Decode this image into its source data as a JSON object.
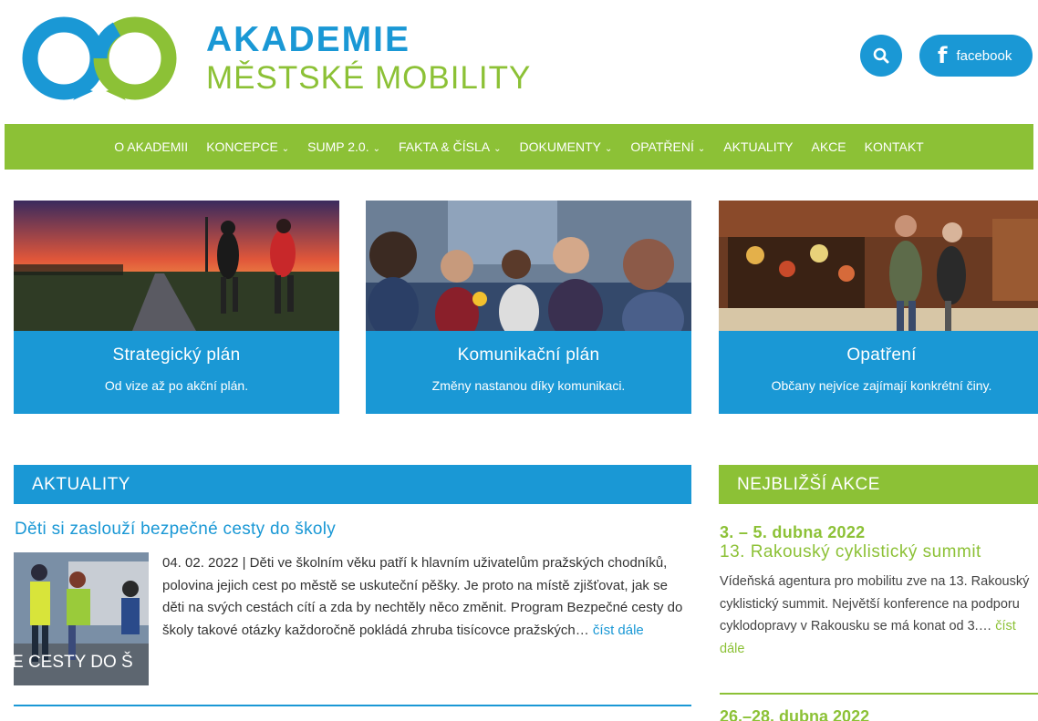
{
  "brand": {
    "line1": "AKADEMIE",
    "line2": "MĚSTSKÉ MOBILITY"
  },
  "header": {
    "search_icon": "search-icon",
    "facebook_icon": "facebook-icon",
    "facebook_label": "facebook"
  },
  "nav": {
    "items": [
      {
        "label": "O AKADEMII",
        "dropdown": false
      },
      {
        "label": "KONCEPCE",
        "dropdown": true
      },
      {
        "label": "SUMP 2.0.",
        "dropdown": true
      },
      {
        "label": "FAKTA & ČÍSLA",
        "dropdown": true
      },
      {
        "label": "DOKUMENTY",
        "dropdown": true
      },
      {
        "label": "OPATŘENÍ",
        "dropdown": true
      },
      {
        "label": "AKTUALITY",
        "dropdown": false
      },
      {
        "label": "AKCE",
        "dropdown": false
      },
      {
        "label": "KONTAKT",
        "dropdown": false
      }
    ]
  },
  "cards": [
    {
      "title": "Strategický plán",
      "subtitle": "Od vize až po akční plán."
    },
    {
      "title": "Komunikační plán",
      "subtitle": "Změny nastanou díky komunikaci."
    },
    {
      "title": "Opatření",
      "subtitle": "Občany nejvíce zajímají konkrétní činy."
    }
  ],
  "news": {
    "heading": "AKTUALITY",
    "item": {
      "title": "Děti si zaslouží bezpečné cesty do školy",
      "thumb_caption": "E CESTY DO Š",
      "date": "04. 02. 2022",
      "separator": " | ",
      "excerpt": "Děti ve školním věku patří k hlavním uživatelům pražských chodníků, polovina jejich cest po městě se uskuteční pěšky. Je proto na místě zjišťovat, jak se děti na svých cestách cítí a zda by nechtěly něco změnit. Program Bezpečné cesty do školy takové otázky každoročně pokládá zhruba tisícovce pražských… ",
      "more": "číst dále"
    }
  },
  "events": {
    "heading": "NEJBLIŽŠÍ AKCE",
    "item": {
      "date": "3. – 5. dubna 2022",
      "title": "13. Rakouský cyklistický summit",
      "text": "Vídeňská agentura pro mobilitu zve na 13. Rakouský cyklistický summit. Největší konference na podporu cyklodopravy v Rakousku se má konat od 3.… ",
      "more": "číst dále"
    },
    "next_date": "26.–28. dubna 2022"
  },
  "colors": {
    "blue": "#1a98d5",
    "green": "#8cc136"
  }
}
